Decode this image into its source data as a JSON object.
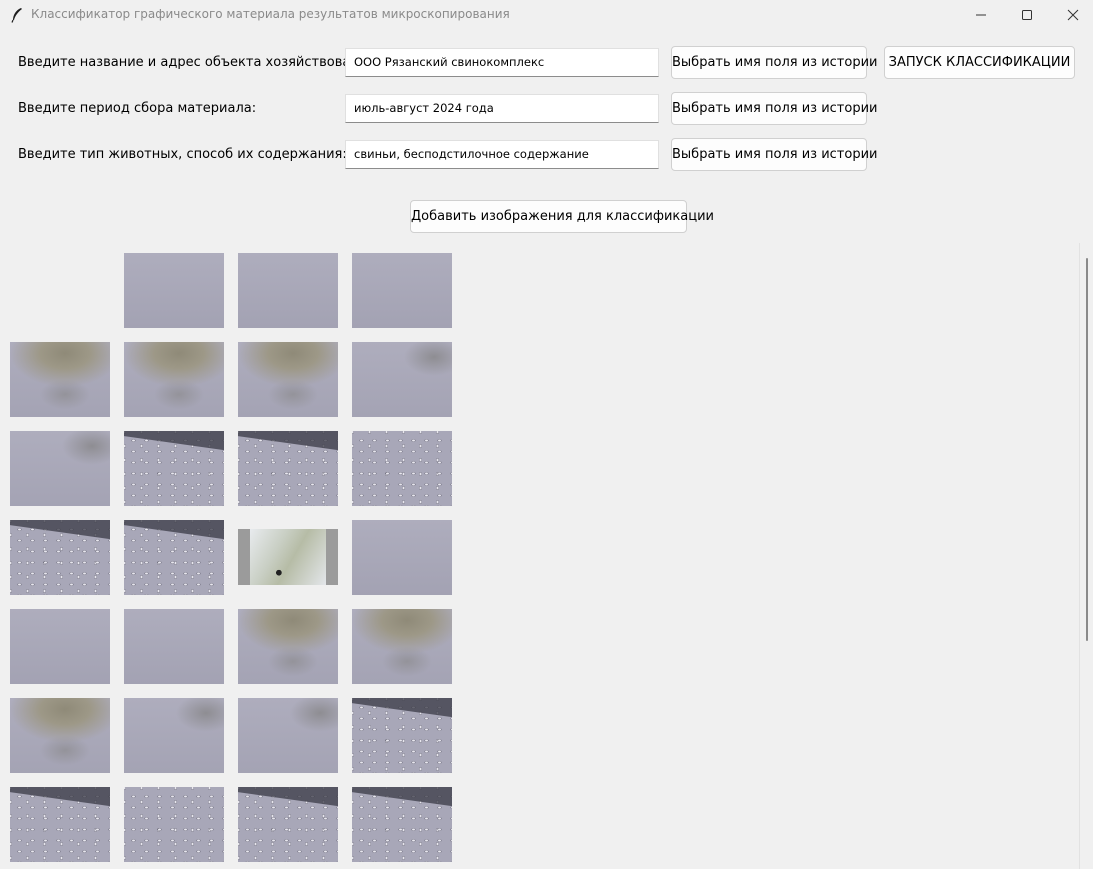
{
  "window": {
    "title": "Классификатор графического материала результатов микроскопирования",
    "icons": {
      "app": "feather-icon",
      "minimize": "minimize-icon",
      "maximize": "maximize-icon",
      "close": "close-icon"
    }
  },
  "form": {
    "fields": [
      {
        "label": "Введите название и адрес объекта хозяйствования:",
        "value": "ООО Рязанский свинокомплекс",
        "history_button": "Выбрать имя поля из истории"
      },
      {
        "label": "Введите период сбора материала:",
        "value": "июль-август 2024 года",
        "history_button": "Выбрать имя поля из истории"
      },
      {
        "label": "Введите тип животных, способ их содержания:",
        "value": "свиньи, бесподстилочное содержание",
        "history_button": "Выбрать имя поля из истории"
      }
    ],
    "run_button": "ЗАПУСК КЛАССИФИКАЦИИ",
    "add_images_button": "Добавить изображения для классификации"
  },
  "gallery": {
    "columns": 4,
    "rows_visible": 7,
    "images_visible": 27
  }
}
